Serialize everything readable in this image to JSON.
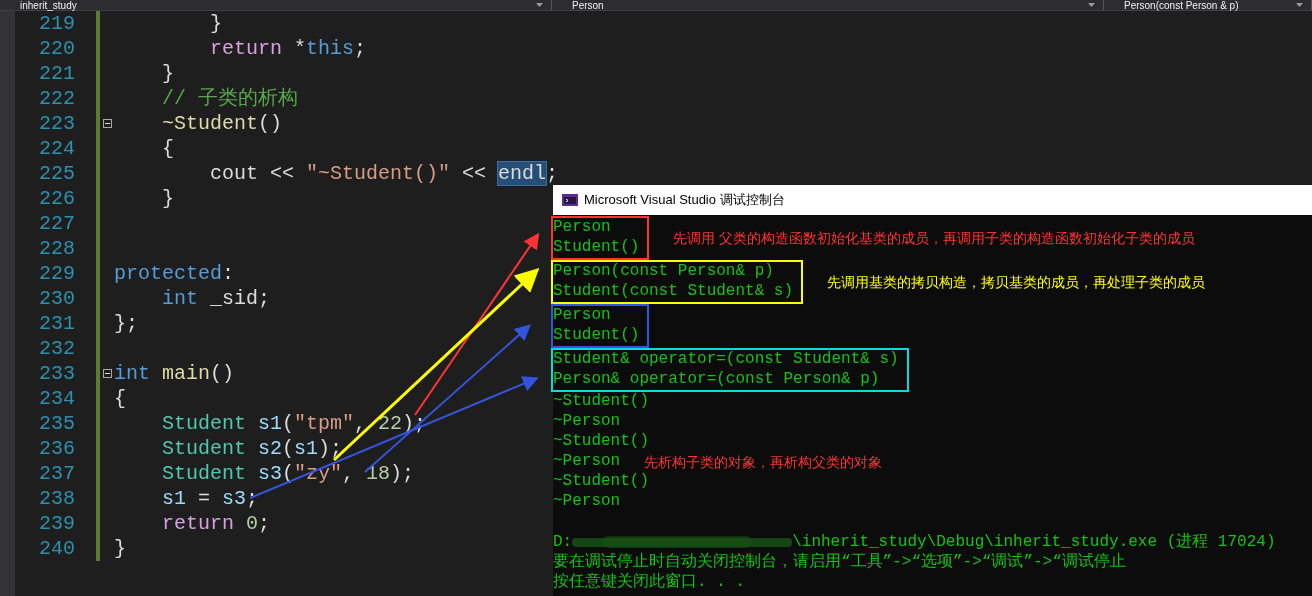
{
  "toolbar": {
    "dropdowns": [
      "inherit_study",
      "Person",
      "Person(const Person & p)"
    ]
  },
  "editor": {
    "lines": [
      {
        "number": "219",
        "fold": false,
        "tokens": [
          {
            "kind": "plain",
            "text": "        }"
          }
        ]
      },
      {
        "number": "220",
        "fold": false,
        "tokens": [
          {
            "kind": "control",
            "text": "        return "
          },
          {
            "kind": "plain",
            "text": "*"
          },
          {
            "kind": "keyword",
            "text": "this"
          },
          {
            "kind": "plain",
            "text": ";"
          }
        ]
      },
      {
        "number": "221",
        "fold": false,
        "tokens": [
          {
            "kind": "plain",
            "text": "    }"
          }
        ]
      },
      {
        "number": "222",
        "fold": false,
        "tokens": [
          {
            "kind": "comment",
            "text": "    // 子类的析构"
          }
        ]
      },
      {
        "number": "223",
        "fold": true,
        "tokens": [
          {
            "kind": "function",
            "text": "    ~Student"
          },
          {
            "kind": "plain",
            "text": "()"
          }
        ]
      },
      {
        "number": "224",
        "fold": false,
        "tokens": [
          {
            "kind": "plain",
            "text": "    {"
          }
        ]
      },
      {
        "number": "225",
        "fold": false,
        "tokens": [
          {
            "kind": "plain",
            "text": "        cout << "
          },
          {
            "kind": "string",
            "text": "\"~Student()\""
          },
          {
            "kind": "plain",
            "text": " << "
          },
          {
            "kind": "selected",
            "text": "endl"
          },
          {
            "kind": "plain",
            "text": ";"
          }
        ]
      },
      {
        "number": "226",
        "fold": false,
        "tokens": [
          {
            "kind": "plain",
            "text": "    }"
          }
        ]
      },
      {
        "number": "227",
        "fold": false
      },
      {
        "number": "228",
        "fold": false
      },
      {
        "number": "229",
        "fold": false,
        "tokens": [
          {
            "kind": "keyword",
            "text": "protected"
          },
          {
            "kind": "plain",
            "text": ":"
          }
        ]
      },
      {
        "number": "230",
        "fold": false,
        "tokens": [
          {
            "kind": "keyword",
            "text": "    int "
          },
          {
            "kind": "plain",
            "text": "_sid;"
          }
        ]
      },
      {
        "number": "231",
        "fold": false,
        "tokens": [
          {
            "kind": "plain",
            "text": "};"
          }
        ]
      },
      {
        "number": "232",
        "fold": false
      },
      {
        "number": "233",
        "fold": true,
        "tokens": [
          {
            "kind": "keyword",
            "text": "int "
          },
          {
            "kind": "function",
            "text": "main"
          },
          {
            "kind": "plain",
            "text": "()"
          }
        ]
      },
      {
        "number": "234",
        "fold": false,
        "tokens": [
          {
            "kind": "plain",
            "text": "{"
          }
        ]
      },
      {
        "number": "235",
        "fold": false,
        "tokens": [
          {
            "kind": "type",
            "text": "    Student "
          },
          {
            "kind": "variable",
            "text": "s1"
          },
          {
            "kind": "plain",
            "text": "("
          },
          {
            "kind": "string",
            "text": "\"tpm\""
          },
          {
            "kind": "plain",
            "text": ", "
          },
          {
            "kind": "number",
            "text": "22"
          },
          {
            "kind": "plain",
            "text": ");"
          }
        ]
      },
      {
        "number": "236",
        "fold": false,
        "tokens": [
          {
            "kind": "type",
            "text": "    Student "
          },
          {
            "kind": "variable",
            "text": "s2"
          },
          {
            "kind": "plain",
            "text": "("
          },
          {
            "kind": "variable",
            "text": "s1"
          },
          {
            "kind": "plain",
            "text": ");"
          }
        ]
      },
      {
        "number": "237",
        "fold": false,
        "tokens": [
          {
            "kind": "type",
            "text": "    Student "
          },
          {
            "kind": "variable",
            "text": "s3"
          },
          {
            "kind": "plain",
            "text": "("
          },
          {
            "kind": "string",
            "text": "\"zy\""
          },
          {
            "kind": "plain",
            "text": ", "
          },
          {
            "kind": "number",
            "text": "18"
          },
          {
            "kind": "plain",
            "text": ");"
          }
        ]
      },
      {
        "number": "238",
        "fold": false,
        "tokens": [
          {
            "kind": "variable",
            "text": "    s1"
          },
          {
            "kind": "plain",
            "text": " = "
          },
          {
            "kind": "variable",
            "text": "s3"
          },
          {
            "kind": "plain",
            "text": ";"
          }
        ]
      },
      {
        "number": "239",
        "fold": false,
        "tokens": [
          {
            "kind": "control",
            "text": "    return "
          },
          {
            "kind": "number",
            "text": "0"
          },
          {
            "kind": "plain",
            "text": ";"
          }
        ]
      },
      {
        "number": "240",
        "fold": false,
        "tokens": [
          {
            "kind": "plain",
            "text": "}"
          }
        ]
      }
    ]
  },
  "console": {
    "title": "Microsoft Visual Studio 调试控制台",
    "blocks": [
      {
        "color": "#ff3333",
        "lines": [
          "Person",
          "Student()"
        ],
        "note": {
          "text": "先调用 父类的构造函数初始化基类的成员，再调用子类的构造函数初始化子类的成员",
          "color": "#ff3333"
        }
      },
      {
        "color": "#ffff00",
        "lines": [
          "Person(const Person& p)",
          "Student(const Student& s)"
        ],
        "note": {
          "text": "先调用基类的拷贝构造，拷贝基类的成员，再处理子类的成员",
          "color": "#ffff00"
        }
      },
      {
        "color": "#3355dd",
        "lines": [
          "Person",
          "Student()"
        ]
      },
      {
        "color": "#00dddd",
        "lines": [
          "Student& operator=(const Student& s)",
          "Person& operator=(const Person& p)"
        ]
      },
      {
        "lines": [
          "~Student()",
          "~Person",
          "~Student()"
        ]
      },
      {
        "lines": [
          "~Person"
        ],
        "note": {
          "text": "先析构子类的对象，再析构父类的对象",
          "color": "#ff3333"
        }
      },
      {
        "lines": [
          "~Student()",
          "~Person"
        ]
      }
    ],
    "path_start": "D:",
    "path_end": "\\inherit_study\\Debug\\inherit_study.exe (进程 17024)",
    "messages": [
      "要在调试停止时自动关闭控制台，请启用“工具”->“选项”->“调试”->“调试停止",
      "按任意键关闭此窗口. . ."
    ]
  }
}
